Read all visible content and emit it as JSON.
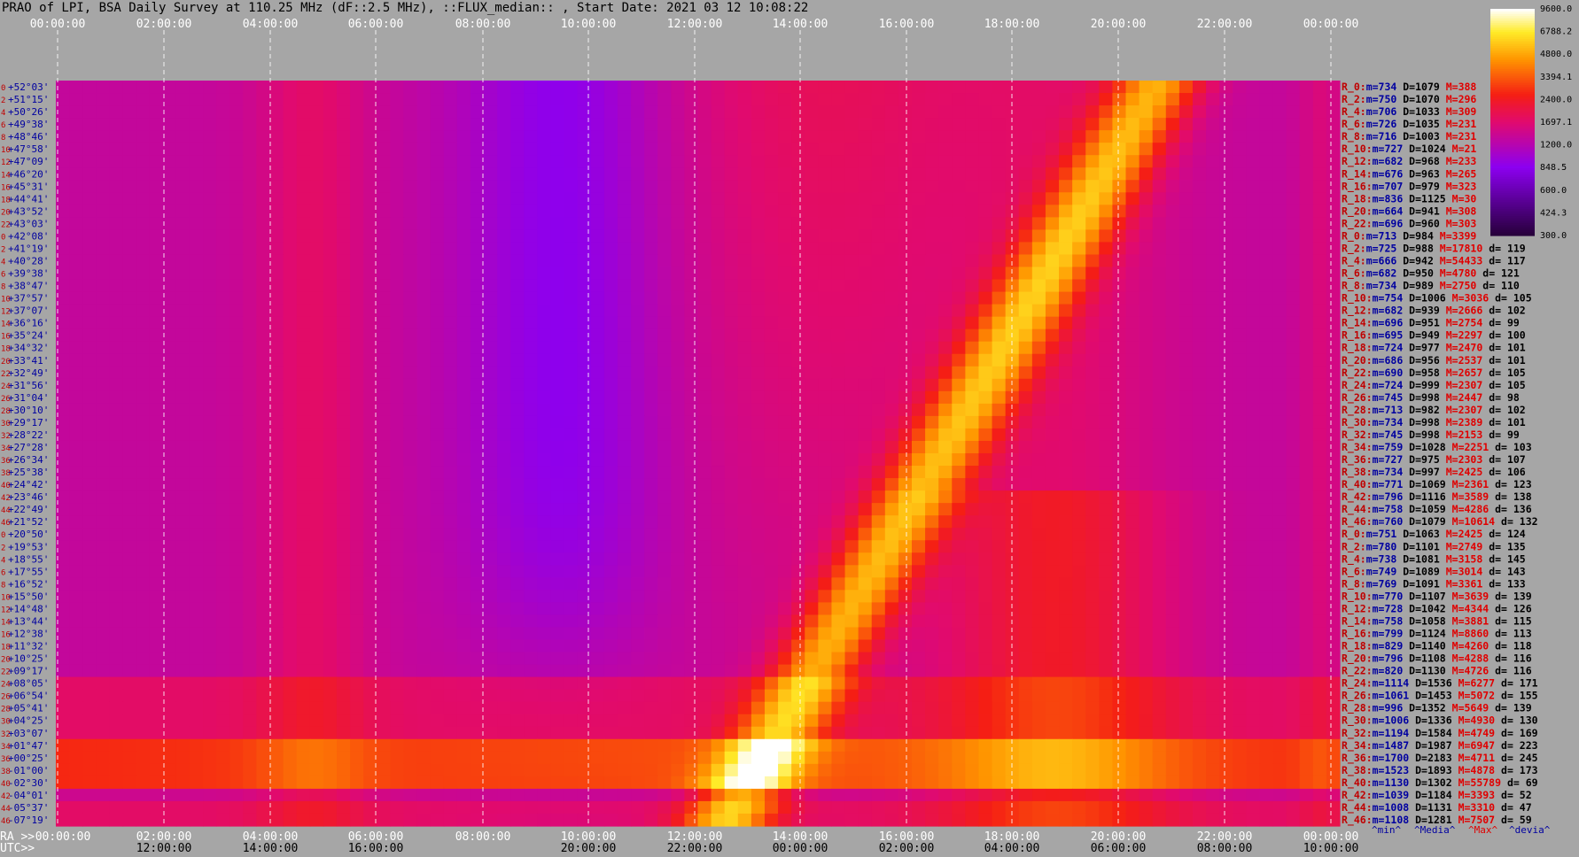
{
  "title": "PRAO of LPI, BSA Daily Survey at 110.25 MHz (dF::2.5 MHz), ::FLUX_median:: , Start Date: 2021 03 12 10:08:22",
  "chart_data": {
    "type": "heatmap",
    "top_time_labels": [
      "00:00:00",
      "02:00:00",
      "04:00:00",
      "06:00:00",
      "08:00:00",
      "10:00:00",
      "12:00:00",
      "14:00:00",
      "16:00:00",
      "18:00:00",
      "20:00:00",
      "22:00:00",
      "00:00:00"
    ],
    "bottom_ra_prefix": "RA >>",
    "bottom_ra_labels": [
      "00:00:00",
      "02:00:00",
      "04:00:00",
      "06:00:00",
      "08:00:00",
      "10:00:00",
      "12:00:00",
      "14:00:00",
      "16:00:00",
      "18:00:00",
      "20:00:00",
      "22:00:00",
      "00:00:00"
    ],
    "bottom_utc_prefix": "UTC>>",
    "bottom_utc_labels": [
      "12:00:00",
      "14:00:00",
      "16:00:00",
      "20:00:00",
      "22:00:00",
      "00:00:00",
      "02:00:00",
      "04:00:00",
      "06:00:00",
      "08:00:00",
      "10:00:00"
    ],
    "colorbar": {
      "ticks": [
        "9600.0",
        "6788.2",
        "4800.0",
        "3394.1",
        "2400.0",
        "1697.1",
        "1200.0",
        "848.5",
        "600.0",
        "424.3",
        "300.0"
      ]
    },
    "rows": [
      {
        "idx": "0",
        "dec": "+52°03'",
        "ch": "R_0:",
        "m": "734",
        "D": "1079",
        "M": "388",
        "d": ""
      },
      {
        "idx": "2",
        "dec": "+51°15'",
        "ch": "R_2:",
        "m": "750",
        "D": "1070",
        "M": "296",
        "d": ""
      },
      {
        "idx": "4",
        "dec": "+50°26'",
        "ch": "R_4:",
        "m": "706",
        "D": "1033",
        "M": "309",
        "d": ""
      },
      {
        "idx": "6",
        "dec": "+49°38'",
        "ch": "R_6:",
        "m": "726",
        "D": "1035",
        "M": "231",
        "d": ""
      },
      {
        "idx": "8",
        "dec": "+48°46'",
        "ch": "R_8:",
        "m": "716",
        "D": "1003",
        "M": "231",
        "d": ""
      },
      {
        "idx": "10",
        "dec": "+47°58'",
        "ch": "R_10:",
        "m": "727",
        "D": "1024",
        "M": "21",
        "d": ""
      },
      {
        "idx": "12",
        "dec": "+47°09'",
        "ch": "R_12:",
        "m": "682",
        "D": "968",
        "M": "233",
        "d": ""
      },
      {
        "idx": "14",
        "dec": "+46°20'",
        "ch": "R_14:",
        "m": "676",
        "D": "963",
        "M": "265",
        "d": ""
      },
      {
        "idx": "16",
        "dec": "+45°31'",
        "ch": "R_16:",
        "m": "707",
        "D": "979",
        "M": "323",
        "d": ""
      },
      {
        "idx": "18",
        "dec": "+44°41'",
        "ch": "R_18:",
        "m": "836",
        "D": "1125",
        "M": "30",
        "d": ""
      },
      {
        "idx": "20",
        "dec": "+43°52'",
        "ch": "R_20:",
        "m": "664",
        "D": "941",
        "M": "308",
        "d": ""
      },
      {
        "idx": "22",
        "dec": "+43°03'",
        "ch": "R_22:",
        "m": "696",
        "D": "960",
        "M": "303",
        "d": ""
      },
      {
        "idx": "0",
        "dec": "+42°08'",
        "ch": "R_0:",
        "m": "713",
        "D": "984",
        "M": "3399",
        "d": ""
      },
      {
        "idx": "2",
        "dec": "+41°19'",
        "ch": "R_2:",
        "m": "725",
        "D": "988",
        "M": "17810",
        "d": "119"
      },
      {
        "idx": "4",
        "dec": "+40°28'",
        "ch": "R_4:",
        "m": "666",
        "D": "942",
        "M": "54433",
        "d": "117"
      },
      {
        "idx": "6",
        "dec": "+39°38'",
        "ch": "R_6:",
        "m": "682",
        "D": "950",
        "M": "4780",
        "d": "121"
      },
      {
        "idx": "8",
        "dec": "+38°47'",
        "ch": "R_8:",
        "m": "734",
        "D": "989",
        "M": "2750",
        "d": "110"
      },
      {
        "idx": "10",
        "dec": "+37°57'",
        "ch": "R_10:",
        "m": "754",
        "D": "1006",
        "M": "3036",
        "d": "105"
      },
      {
        "idx": "12",
        "dec": "+37°07'",
        "ch": "R_12:",
        "m": "682",
        "D": "939",
        "M": "2666",
        "d": "102"
      },
      {
        "idx": "14",
        "dec": "+36°16'",
        "ch": "R_14:",
        "m": "696",
        "D": "951",
        "M": "2754",
        "d": "99"
      },
      {
        "idx": "16",
        "dec": "+35°24'",
        "ch": "R_16:",
        "m": "695",
        "D": "949",
        "M": "2297",
        "d": "100"
      },
      {
        "idx": "18",
        "dec": "+34°32'",
        "ch": "R_18:",
        "m": "724",
        "D": "977",
        "M": "2470",
        "d": "101"
      },
      {
        "idx": "20",
        "dec": "+33°41'",
        "ch": "R_20:",
        "m": "686",
        "D": "956",
        "M": "2537",
        "d": "101"
      },
      {
        "idx": "22",
        "dec": "+32°49'",
        "ch": "R_22:",
        "m": "690",
        "D": "958",
        "M": "2657",
        "d": "105"
      },
      {
        "idx": "24",
        "dec": "+31°56'",
        "ch": "R_24:",
        "m": "724",
        "D": "999",
        "M": "2307",
        "d": "105"
      },
      {
        "idx": "26",
        "dec": "+31°04'",
        "ch": "R_26:",
        "m": "745",
        "D": "998",
        "M": "2447",
        "d": "98"
      },
      {
        "idx": "28",
        "dec": "+30°10'",
        "ch": "R_28:",
        "m": "713",
        "D": "982",
        "M": "2307",
        "d": "102"
      },
      {
        "idx": "30",
        "dec": "+29°17'",
        "ch": "R_30:",
        "m": "734",
        "D": "998",
        "M": "2389",
        "d": "101"
      },
      {
        "idx": "32",
        "dec": "+28°22'",
        "ch": "R_32:",
        "m": "745",
        "D": "998",
        "M": "2153",
        "d": "99"
      },
      {
        "idx": "34",
        "dec": "+27°28'",
        "ch": "R_34:",
        "m": "759",
        "D": "1028",
        "M": "2251",
        "d": "103"
      },
      {
        "idx": "36",
        "dec": "+26°34'",
        "ch": "R_36:",
        "m": "727",
        "D": "975",
        "M": "2303",
        "d": "107"
      },
      {
        "idx": "38",
        "dec": "+25°38'",
        "ch": "R_38:",
        "m": "734",
        "D": "997",
        "M": "2425",
        "d": "106"
      },
      {
        "idx": "40",
        "dec": "+24°42'",
        "ch": "R_40:",
        "m": "771",
        "D": "1069",
        "M": "2361",
        "d": "123"
      },
      {
        "idx": "42",
        "dec": "+23°46'",
        "ch": "R_42:",
        "m": "796",
        "D": "1116",
        "M": "3589",
        "d": "138"
      },
      {
        "idx": "44",
        "dec": "+22°49'",
        "ch": "R_44:",
        "m": "758",
        "D": "1059",
        "M": "4286",
        "d": "136"
      },
      {
        "idx": "46",
        "dec": "+21°52'",
        "ch": "R_46:",
        "m": "760",
        "D": "1079",
        "M": "10614",
        "d": "132"
      },
      {
        "idx": "0",
        "dec": "+20°50'",
        "ch": "R_0:",
        "m": "751",
        "D": "1063",
        "M": "2425",
        "d": "124"
      },
      {
        "idx": "2",
        "dec": "+19°53'",
        "ch": "R_2:",
        "m": "780",
        "D": "1101",
        "M": "2749",
        "d": "135"
      },
      {
        "idx": "4",
        "dec": "+18°55'",
        "ch": "R_4:",
        "m": "738",
        "D": "1081",
        "M": "3158",
        "d": "145"
      },
      {
        "idx": "6",
        "dec": "+17°55'",
        "ch": "R_6:",
        "m": "749",
        "D": "1089",
        "M": "3014",
        "d": "143"
      },
      {
        "idx": "8",
        "dec": "+16°52'",
        "ch": "R_8:",
        "m": "769",
        "D": "1091",
        "M": "3361",
        "d": "133"
      },
      {
        "idx": "10",
        "dec": "+15°50'",
        "ch": "R_10:",
        "m": "770",
        "D": "1107",
        "M": "3639",
        "d": "139"
      },
      {
        "idx": "12",
        "dec": "+14°48'",
        "ch": "R_12:",
        "m": "728",
        "D": "1042",
        "M": "4344",
        "d": "126"
      },
      {
        "idx": "14",
        "dec": "+13°44'",
        "ch": "R_14:",
        "m": "758",
        "D": "1058",
        "M": "3881",
        "d": "115"
      },
      {
        "idx": "16",
        "dec": "+12°38'",
        "ch": "R_16:",
        "m": "799",
        "D": "1124",
        "M": "8860",
        "d": "113"
      },
      {
        "idx": "18",
        "dec": "+11°32'",
        "ch": "R_18:",
        "m": "829",
        "D": "1140",
        "M": "4260",
        "d": "118"
      },
      {
        "idx": "20",
        "dec": "+10°25'",
        "ch": "R_20:",
        "m": "796",
        "D": "1108",
        "M": "4288",
        "d": "116"
      },
      {
        "idx": "22",
        "dec": "+09°17'",
        "ch": "R_22:",
        "m": "820",
        "D": "1130",
        "M": "4726",
        "d": "116"
      },
      {
        "idx": "24",
        "dec": "+08°05'",
        "ch": "R_24:",
        "m": "1114",
        "D": "1536",
        "M": "6277",
        "d": "171"
      },
      {
        "idx": "26",
        "dec": "+06°54'",
        "ch": "R_26:",
        "m": "1061",
        "D": "1453",
        "M": "5072",
        "d": "155"
      },
      {
        "idx": "28",
        "dec": "+05°41'",
        "ch": "R_28:",
        "m": "996",
        "D": "1352",
        "M": "5649",
        "d": "139"
      },
      {
        "idx": "30",
        "dec": "+04°25'",
        "ch": "R_30:",
        "m": "1006",
        "D": "1336",
        "M": "4930",
        "d": "130"
      },
      {
        "idx": "32",
        "dec": "+03°07'",
        "ch": "R_32:",
        "m": "1194",
        "D": "1584",
        "M": "4749",
        "d": "169"
      },
      {
        "idx": "34",
        "dec": "+01°47'",
        "ch": "R_34:",
        "m": "1487",
        "D": "1987",
        "M": "6947",
        "d": "223"
      },
      {
        "idx": "36",
        "dec": "+00°25'",
        "ch": "R_36:",
        "m": "1700",
        "D": "2183",
        "M": "4711",
        "d": "245"
      },
      {
        "idx": "38",
        "dec": "-01°00'",
        "ch": "R_38:",
        "m": "1523",
        "D": "1893",
        "M": "4878",
        "d": "173"
      },
      {
        "idx": "40",
        "dec": "-02°30'",
        "ch": "R_40:",
        "m": "1130",
        "D": "1302",
        "M": "55789",
        "d": "69"
      },
      {
        "idx": "42",
        "dec": "-04°01'",
        "ch": "R_42:",
        "m": "1039",
        "D": "1184",
        "M": "3393",
        "d": "52"
      },
      {
        "idx": "44",
        "dec": "-05°37'",
        "ch": "R_44:",
        "m": "1008",
        "D": "1131",
        "M": "3310",
        "d": "47"
      },
      {
        "idx": "46",
        "dec": "-07°19'",
        "ch": "R_46:",
        "m": "1108",
        "D": "1281",
        "M": "7507",
        "d": "59"
      }
    ],
    "stat_prefixes": {
      "m": "m=",
      "D": "D=",
      "M": "M=",
      "d": "d= "
    },
    "footer_labels": [
      "^min^",
      "^Media^",
      "^Max^",
      "^devia^"
    ],
    "colors": {
      "background": "#a6a6a6",
      "dec_label": "#0000a0",
      "idx_label": "#c00000",
      "stat_ch": "#c00000",
      "stat_m": "#0000a0",
      "stat_D": "#000000",
      "stat_M": "#e00000",
      "stat_d": "#000000",
      "footer_label": "#0000a0"
    }
  }
}
